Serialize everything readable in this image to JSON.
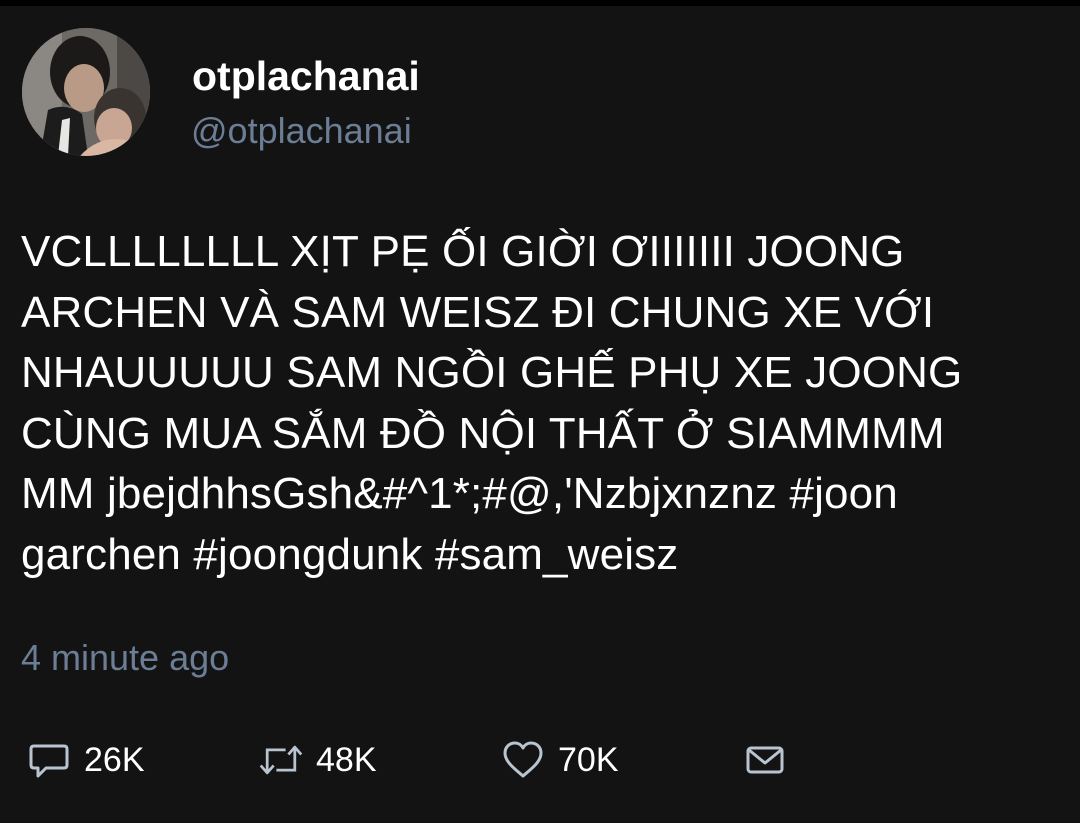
{
  "author": {
    "display_name": "otplachanai",
    "handle": "@otplachanai",
    "avatar_icon": "profile-photo"
  },
  "tweet": {
    "text": "VCLLLLLLLL XỊT PẸ ỐI GIỜI ƠIIIIIII JOONG\nARCHEN VÀ SAM WEISZ ĐI CHUNG XE VỚI\nNHAUUUUU SAM NGỒI GHẾ PHỤ XE JOONG\nCÙNG MUA SẮM ĐỒ NỘI THẤT Ở SIAMMMM\nMM jbejdhhsGsh&#^1*;#@,'Nzbjxnznz #joon\ngarchen #joongdunk #sam_weisz",
    "timestamp": "4 minute ago"
  },
  "actions": {
    "reply": {
      "icon": "comment-icon",
      "count": "26K"
    },
    "retweet": {
      "icon": "retweet-icon",
      "count": "48K"
    },
    "like": {
      "icon": "heart-icon",
      "count": "70K"
    },
    "share": {
      "icon": "mail-icon"
    }
  },
  "colors": {
    "background": "#131313",
    "text": "#ffffff",
    "muted": "#6b7e95",
    "icon": "#b9c4d0"
  }
}
